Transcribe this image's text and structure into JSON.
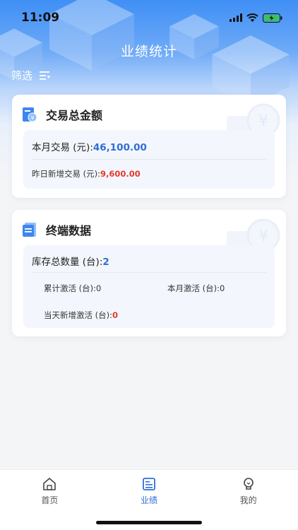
{
  "status": {
    "time": "11:09"
  },
  "header": {
    "title": "业绩统计",
    "filter_label": "筛选"
  },
  "transaction_card": {
    "title": "交易总金额",
    "monthly_label": "本月交易 (元):",
    "monthly_value": "46,100.00",
    "yesterday_label": "昨日新增交易 (元):",
    "yesterday_value": "9,600.00"
  },
  "terminal_card": {
    "title": "终端数据",
    "stock_label": "库存总数量 (台):",
    "stock_value": "2",
    "total_activated_label": "累计激活 (台):",
    "total_activated_value": "0",
    "month_activated_label": "本月激活 (台):",
    "month_activated_value": "0",
    "today_activated_label": "当天新增激活 (台):",
    "today_activated_value": "0"
  },
  "tabbar": {
    "items": [
      {
        "label": "首页",
        "icon": "home-icon"
      },
      {
        "label": "业绩",
        "icon": "receipt-icon"
      },
      {
        "label": "我的",
        "icon": "bulb-icon"
      }
    ],
    "active_index": 1
  },
  "colors": {
    "accent": "#2f6ed6",
    "red": "#e23b2e"
  }
}
